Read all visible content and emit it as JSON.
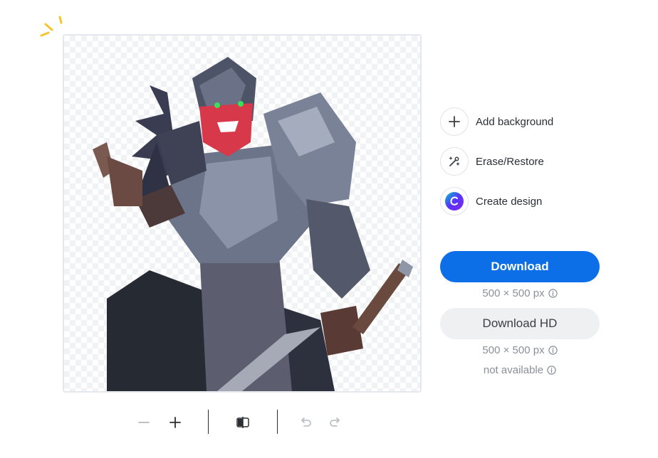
{
  "actions": [
    {
      "label": "Add background",
      "icon": "plus-icon"
    },
    {
      "label": "Erase/Restore",
      "icon": "magic-brush-icon"
    },
    {
      "label": "Create design",
      "icon": "canva-logo-icon"
    }
  ],
  "download": {
    "label": "Download",
    "size": "500 × 500 px"
  },
  "download_hd": {
    "label": "Download HD",
    "size": "500 × 500 px",
    "availability": "not available"
  },
  "toolbar": {
    "tools": [
      "zoom-out-icon",
      "zoom-in-icon",
      "compare-icon",
      "undo-icon",
      "redo-icon"
    ]
  },
  "colors": {
    "primary": "#0d6fe8",
    "secondary_bg": "#eef0f2",
    "meta_text": "#8a9099",
    "sparkle": "#f4c430"
  }
}
